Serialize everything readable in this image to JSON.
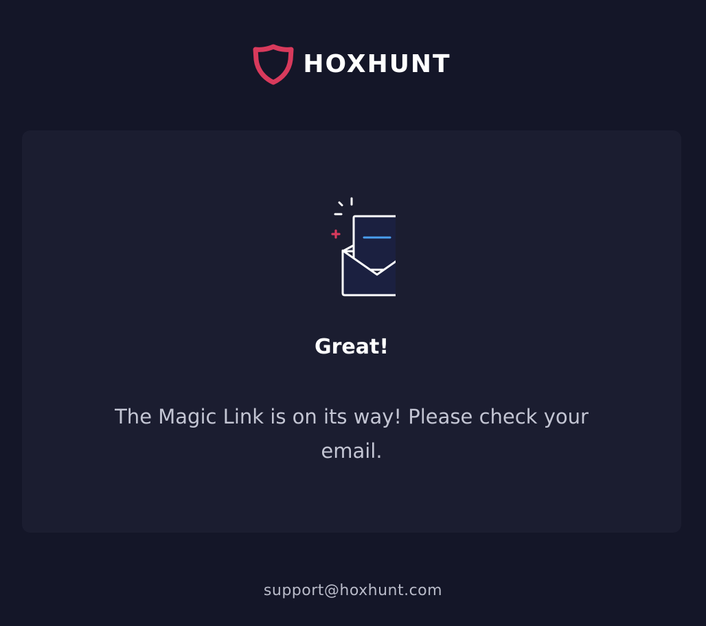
{
  "brand": {
    "name": "HOXHUNT",
    "logo_icon": "shield-logo-icon",
    "accent_color": "#d83a5c"
  },
  "card": {
    "illustration_icon": "open-envelope-icon",
    "title": "Great!",
    "message": "The Magic Link is on its way! Please check your email."
  },
  "footer": {
    "support_email": "support@hoxhunt.com"
  },
  "colors": {
    "background": "#141628",
    "card_background": "#1b1d30",
    "letter_line": "#4a9ff0"
  }
}
